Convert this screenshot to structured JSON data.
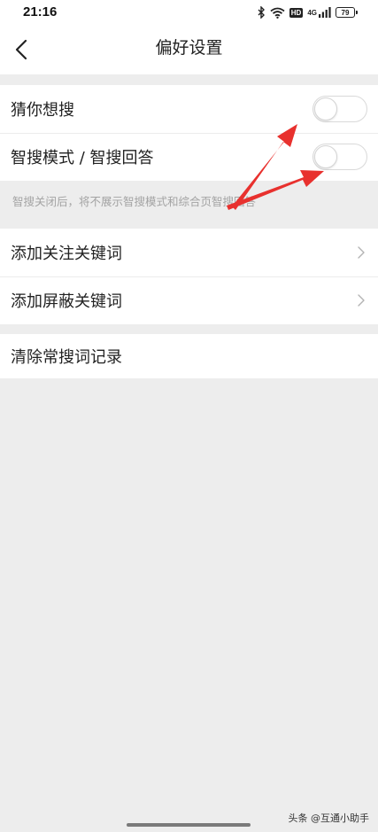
{
  "status_bar": {
    "time": "21:16",
    "signal_label": "4G",
    "hd_label": "HD",
    "battery_level": "79",
    "icons": [
      "bluetooth-icon",
      "wifi-icon",
      "hd-icon",
      "signal-icon",
      "battery-icon"
    ]
  },
  "nav": {
    "title": "偏好设置",
    "back_icon": "chevron-left-icon"
  },
  "smart_section": {
    "items": [
      {
        "label": "猜你想搜",
        "control": "toggle",
        "checked": false
      },
      {
        "label": "智搜模式 / 智搜回答",
        "control": "toggle",
        "checked": false
      }
    ],
    "hint": "智搜关闭后，将不展示智搜模式和综合页智搜回答"
  },
  "keyword_section": {
    "items": [
      {
        "label": "添加关注关键词",
        "control": "chevron-right-icon"
      },
      {
        "label": "添加屏蔽关键词",
        "control": "chevron-right-icon"
      }
    ]
  },
  "history_section": {
    "items": [
      {
        "label": "清除常搜词记录"
      }
    ]
  },
  "annotation": {
    "arrow_color": "#e8312e",
    "arrow_icon": "red-arrow-icon"
  },
  "watermark": "头条 @互通小助手",
  "colors": {
    "background": "#ededed",
    "card": "#ffffff",
    "hint_text": "#a3a3a3"
  }
}
